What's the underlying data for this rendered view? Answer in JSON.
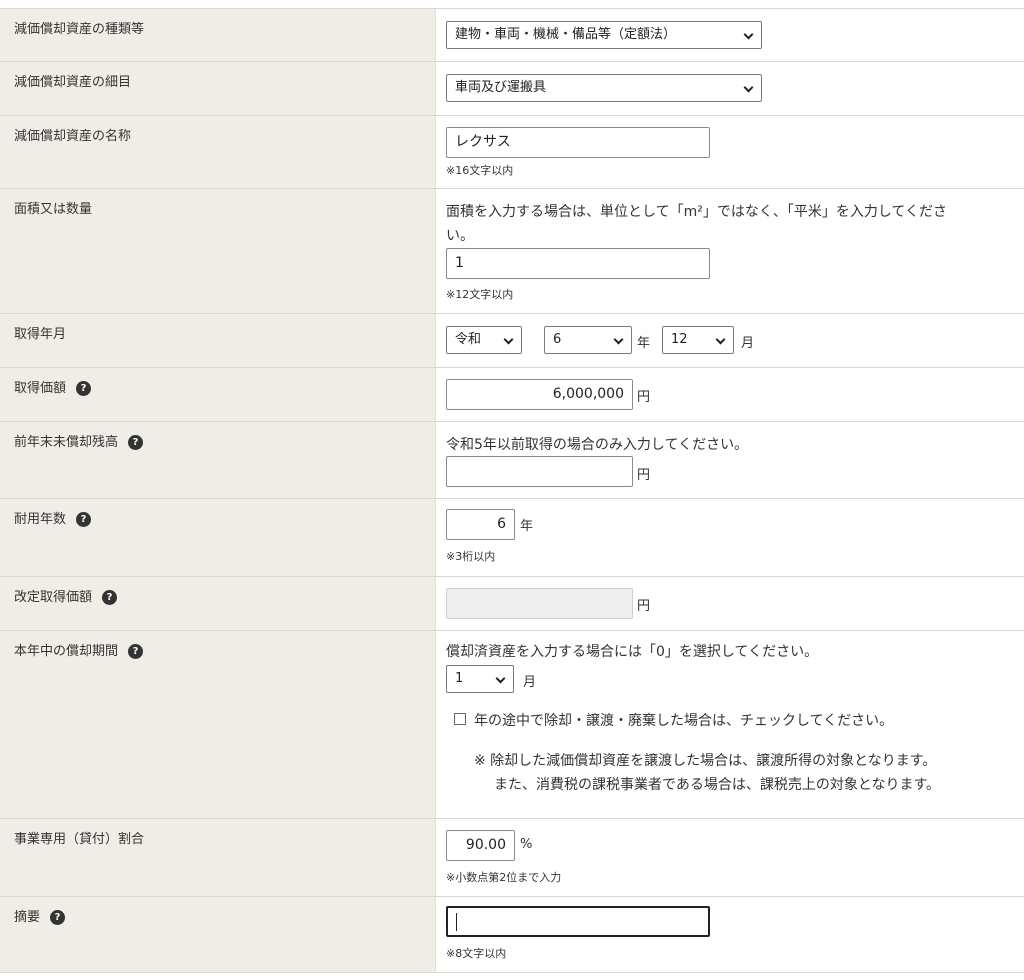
{
  "rows": [
    {
      "label": "減価償却資産の種類等"
    },
    {
      "label": "減価償却資産の細目"
    },
    {
      "label": "減価償却資産の名称"
    },
    {
      "label": "面積又は数量"
    },
    {
      "label": "取得年月"
    },
    {
      "label": "取得価額"
    },
    {
      "label": "前年末未償却残高"
    },
    {
      "label": "耐用年数"
    },
    {
      "label": "改定取得価額"
    },
    {
      "label": "本年中の償却期間"
    },
    {
      "label": "事業専用（貸付）割合"
    },
    {
      "label": "摘要"
    }
  ],
  "asset_type": {
    "value": "建物・車両・機械・備品等（定額法）"
  },
  "asset_detail": {
    "value": "車両及び運搬具"
  },
  "asset_name": {
    "value": "レクサス",
    "note": "※16文字以内"
  },
  "quantity": {
    "instruction": "面積を入力する場合は、単位として「m²」ではなく、「平米」を入力してくださ",
    "instruction2": "い。",
    "value": "1",
    "note": "※12文字以内"
  },
  "acquired": {
    "era": "令和",
    "year": "6",
    "year_unit": "年",
    "month": "12",
    "month_unit": "月"
  },
  "price": {
    "value": "6,000,000",
    "unit": "円"
  },
  "prev_balance": {
    "instruction": "令和5年以前取得の場合のみ入力してください。",
    "value": "",
    "unit": "円"
  },
  "useful_life": {
    "value": "6",
    "unit": "年",
    "note": "※3桁以内"
  },
  "revised_price": {
    "value": "",
    "unit": "円"
  },
  "period": {
    "instruction": "償却済資産を入力する場合には「0」を選択してください。",
    "value": "1",
    "unit": "月",
    "checkbox_label": "年の途中で除却・譲渡・廃棄した場合は、チェックしてください。",
    "checkbox_checked": false,
    "warning1": "※ 除却した減価償却資産を譲渡した場合は、譲渡所得の対象となります。",
    "warning2": "また、消費税の課税事業者である場合は、課税売上の対象となります。"
  },
  "business_ratio": {
    "value": "90.00",
    "unit": "%",
    "note": "※小数点第2位まで入力"
  },
  "summary": {
    "value": "",
    "note": "※8文字以内"
  },
  "help_icon_glyph": "?"
}
